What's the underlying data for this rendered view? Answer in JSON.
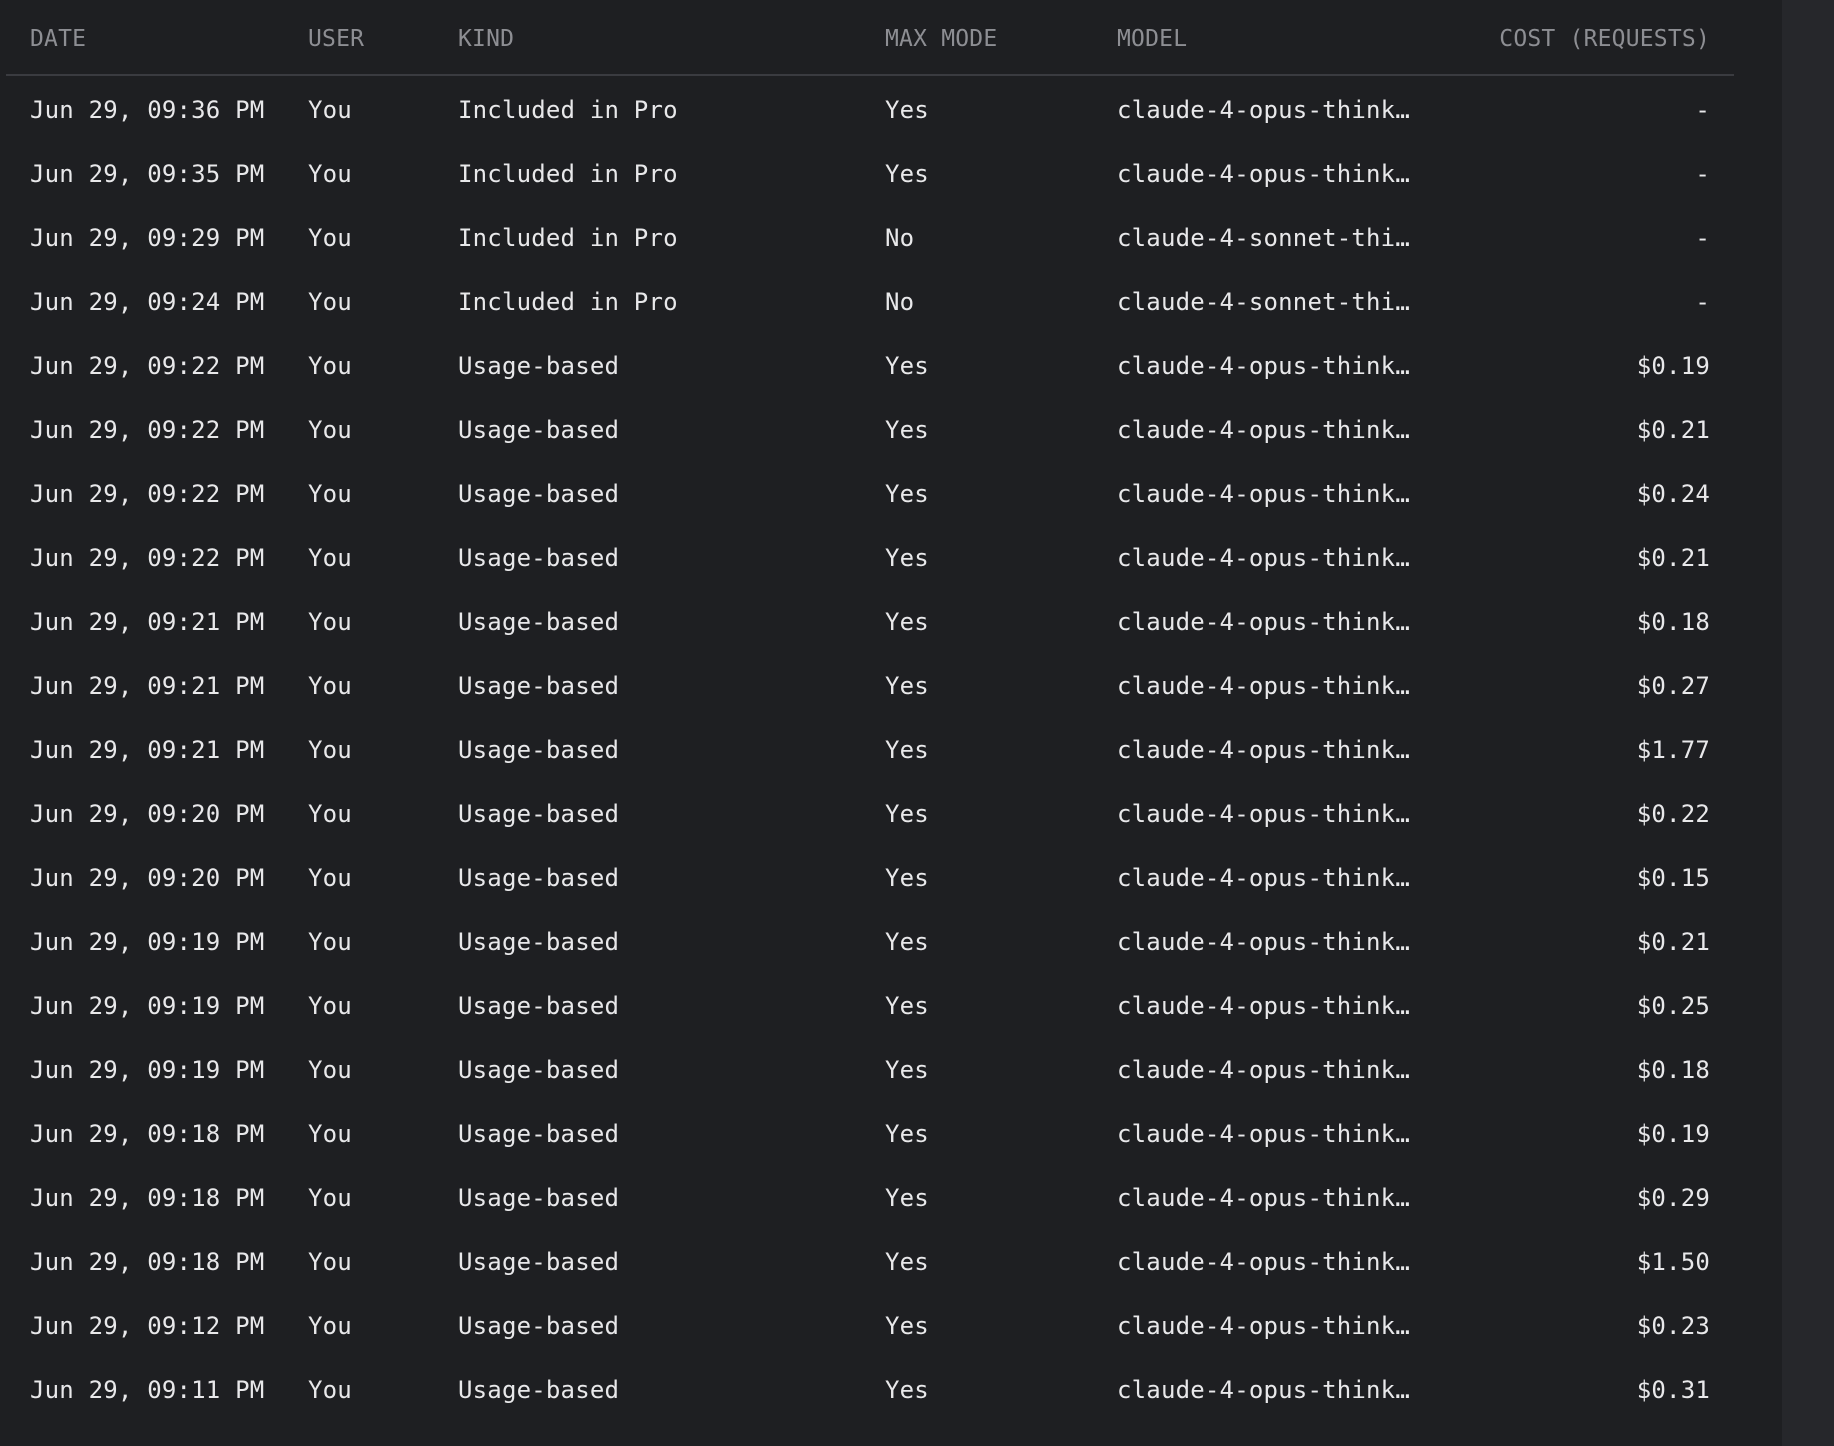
{
  "columns": {
    "date": "DATE",
    "user": "USER",
    "kind": "KIND",
    "max_mode": "MAX MODE",
    "model": "MODEL",
    "cost": "COST (REQUESTS)"
  },
  "rows": [
    {
      "date": "Jun 29, 09:36 PM",
      "user": "You",
      "kind": "Included in Pro",
      "max_mode": "Yes",
      "model": "claude-4-opus-think…",
      "cost": "-"
    },
    {
      "date": "Jun 29, 09:35 PM",
      "user": "You",
      "kind": "Included in Pro",
      "max_mode": "Yes",
      "model": "claude-4-opus-think…",
      "cost": "-"
    },
    {
      "date": "Jun 29, 09:29 PM",
      "user": "You",
      "kind": "Included in Pro",
      "max_mode": "No",
      "model": "claude-4-sonnet-thi…",
      "cost": "-"
    },
    {
      "date": "Jun 29, 09:24 PM",
      "user": "You",
      "kind": "Included in Pro",
      "max_mode": "No",
      "model": "claude-4-sonnet-thi…",
      "cost": "-"
    },
    {
      "date": "Jun 29, 09:22 PM",
      "user": "You",
      "kind": "Usage-based",
      "max_mode": "Yes",
      "model": "claude-4-opus-think…",
      "cost": "$0.19"
    },
    {
      "date": "Jun 29, 09:22 PM",
      "user": "You",
      "kind": "Usage-based",
      "max_mode": "Yes",
      "model": "claude-4-opus-think…",
      "cost": "$0.21"
    },
    {
      "date": "Jun 29, 09:22 PM",
      "user": "You",
      "kind": "Usage-based",
      "max_mode": "Yes",
      "model": "claude-4-opus-think…",
      "cost": "$0.24"
    },
    {
      "date": "Jun 29, 09:22 PM",
      "user": "You",
      "kind": "Usage-based",
      "max_mode": "Yes",
      "model": "claude-4-opus-think…",
      "cost": "$0.21"
    },
    {
      "date": "Jun 29, 09:21 PM",
      "user": "You",
      "kind": "Usage-based",
      "max_mode": "Yes",
      "model": "claude-4-opus-think…",
      "cost": "$0.18"
    },
    {
      "date": "Jun 29, 09:21 PM",
      "user": "You",
      "kind": "Usage-based",
      "max_mode": "Yes",
      "model": "claude-4-opus-think…",
      "cost": "$0.27"
    },
    {
      "date": "Jun 29, 09:21 PM",
      "user": "You",
      "kind": "Usage-based",
      "max_mode": "Yes",
      "model": "claude-4-opus-think…",
      "cost": "$1.77"
    },
    {
      "date": "Jun 29, 09:20 PM",
      "user": "You",
      "kind": "Usage-based",
      "max_mode": "Yes",
      "model": "claude-4-opus-think…",
      "cost": "$0.22"
    },
    {
      "date": "Jun 29, 09:20 PM",
      "user": "You",
      "kind": "Usage-based",
      "max_mode": "Yes",
      "model": "claude-4-opus-think…",
      "cost": "$0.15"
    },
    {
      "date": "Jun 29, 09:19 PM",
      "user": "You",
      "kind": "Usage-based",
      "max_mode": "Yes",
      "model": "claude-4-opus-think…",
      "cost": "$0.21"
    },
    {
      "date": "Jun 29, 09:19 PM",
      "user": "You",
      "kind": "Usage-based",
      "max_mode": "Yes",
      "model": "claude-4-opus-think…",
      "cost": "$0.25"
    },
    {
      "date": "Jun 29, 09:19 PM",
      "user": "You",
      "kind": "Usage-based",
      "max_mode": "Yes",
      "model": "claude-4-opus-think…",
      "cost": "$0.18"
    },
    {
      "date": "Jun 29, 09:18 PM",
      "user": "You",
      "kind": "Usage-based",
      "max_mode": "Yes",
      "model": "claude-4-opus-think…",
      "cost": "$0.19"
    },
    {
      "date": "Jun 29, 09:18 PM",
      "user": "You",
      "kind": "Usage-based",
      "max_mode": "Yes",
      "model": "claude-4-opus-think…",
      "cost": "$0.29"
    },
    {
      "date": "Jun 29, 09:18 PM",
      "user": "You",
      "kind": "Usage-based",
      "max_mode": "Yes",
      "model": "claude-4-opus-think…",
      "cost": "$1.50"
    },
    {
      "date": "Jun 29, 09:12 PM",
      "user": "You",
      "kind": "Usage-based",
      "max_mode": "Yes",
      "model": "claude-4-opus-think…",
      "cost": "$0.23"
    },
    {
      "date": "Jun 29, 09:11 PM",
      "user": "You",
      "kind": "Usage-based",
      "max_mode": "Yes",
      "model": "claude-4-opus-think…",
      "cost": "$0.31"
    }
  ],
  "colors": {
    "background": "#1e1f22",
    "header_text": "#8d8e93",
    "row_text": "#e8e8ea",
    "divider": "#3a3b40",
    "scroll_gutter": "#26272b"
  }
}
